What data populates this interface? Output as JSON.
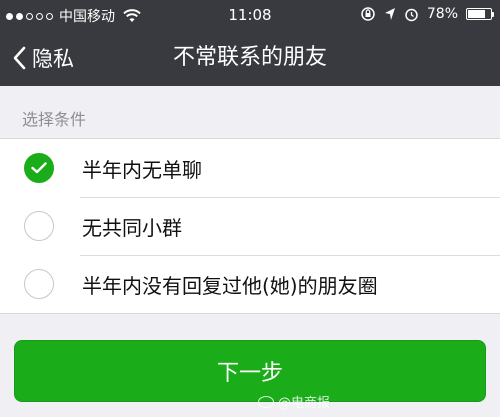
{
  "status_bar": {
    "signal_dots": [
      true,
      true,
      false,
      false,
      false
    ],
    "carrier": "中国移动",
    "time": "11:08",
    "battery_percent": "78%",
    "battery_level": 0.78
  },
  "nav": {
    "back_label": "隐私",
    "title": "不常联系的朋友"
  },
  "section_header": "选择条件",
  "options": [
    {
      "label": "半年内无单聊",
      "checked": true
    },
    {
      "label": "无共同小群",
      "checked": false
    },
    {
      "label": "半年内没有回复过他(她)的朋友圈",
      "checked": false
    }
  ],
  "next_button": "下一步",
  "watermark": "@电商报",
  "colors": {
    "accent": "#1aad19",
    "nav_bg": "#393a3f",
    "page_bg": "#efeff4"
  }
}
